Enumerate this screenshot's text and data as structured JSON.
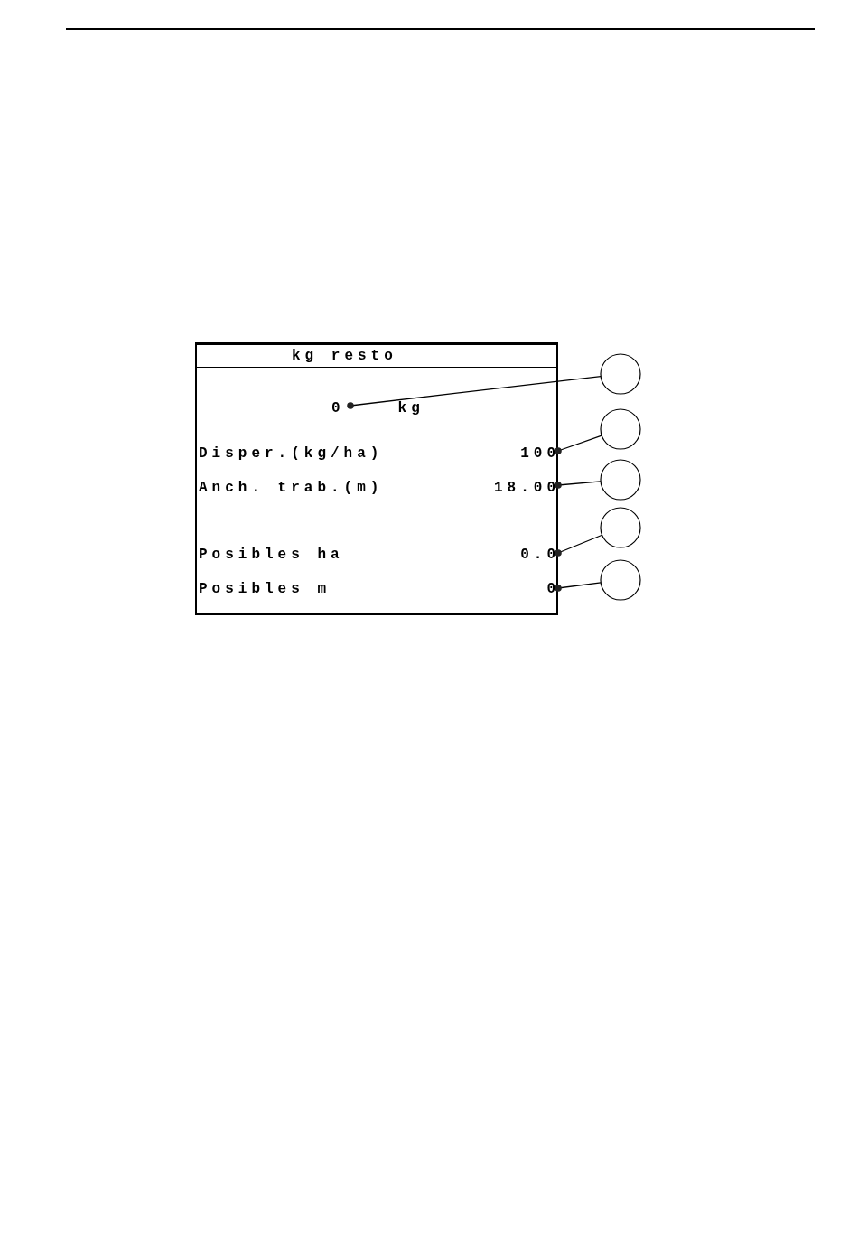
{
  "display": {
    "title": "kg resto",
    "remaining": {
      "value": "0",
      "unit": "kg"
    },
    "row_groups": [
      {
        "rows": [
          {
            "label": "Disper.(kg/ha)",
            "value": "100"
          },
          {
            "label": "Anch. trab.(m)",
            "value": "18.00"
          }
        ]
      },
      {
        "rows": [
          {
            "label": "Posibles ha",
            "value": "0.0"
          },
          {
            "label": "Posibles m",
            "value": "0"
          }
        ]
      }
    ]
  }
}
